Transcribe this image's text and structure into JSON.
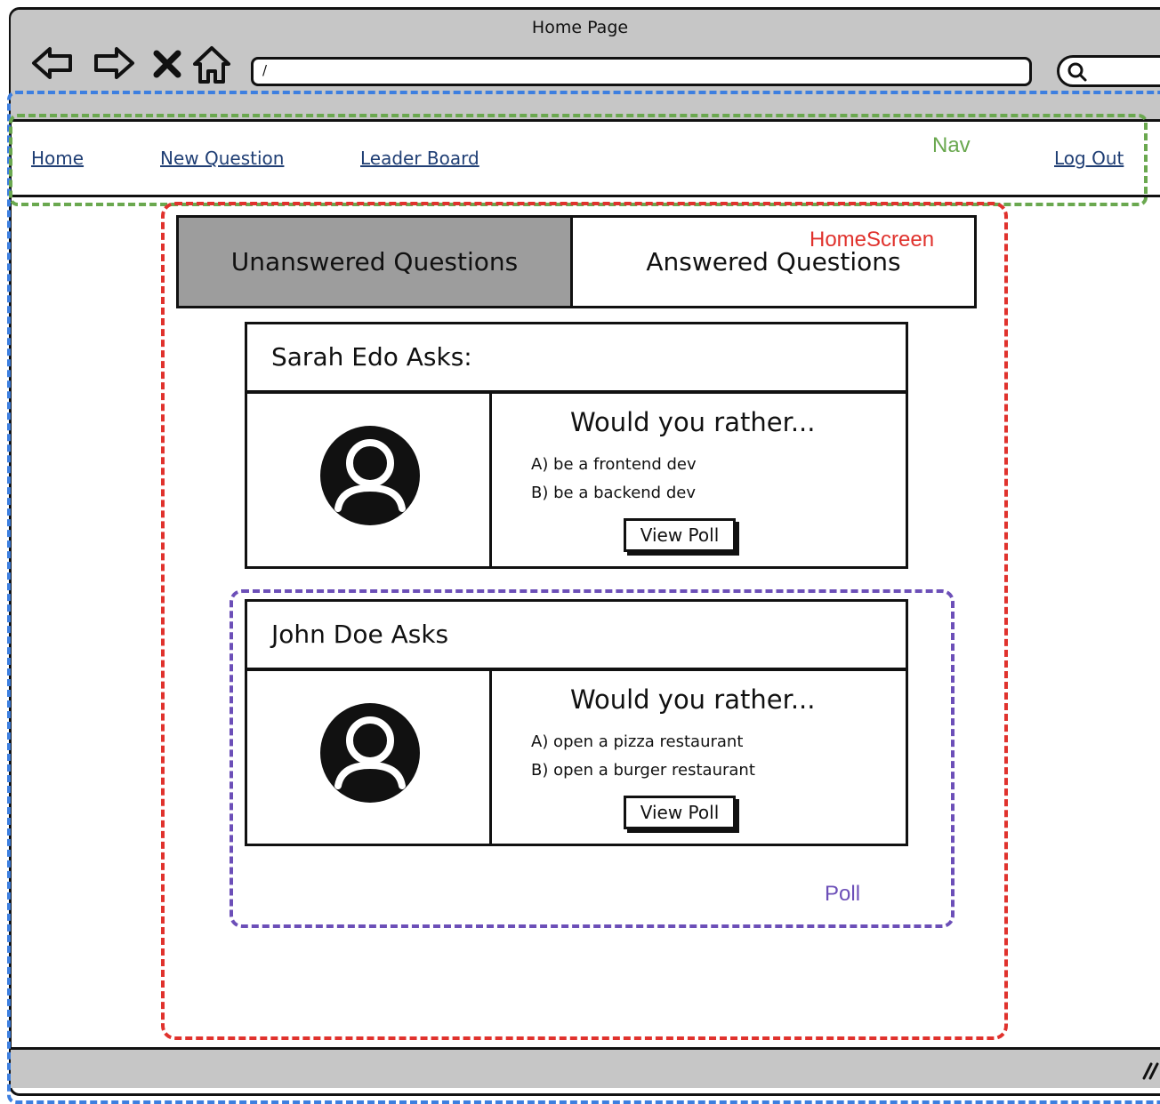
{
  "window": {
    "title": "Home Page"
  },
  "address_bar": {
    "value": "/"
  },
  "toolbar": {
    "back_icon": "back-arrow-icon",
    "forward_icon": "forward-arrow-icon",
    "stop_icon": "close-icon",
    "home_icon": "home-icon",
    "search_icon": "search-icon"
  },
  "nav": {
    "links": [
      "Home",
      "New Question",
      "Leader Board"
    ],
    "logout": "Log Out"
  },
  "annotations": {
    "nav": "Nav",
    "homescreen": "HomeScreen",
    "poll": "Poll",
    "colors": {
      "nav": "#6aa84f",
      "homescreen": "#e0322d",
      "poll": "#6c4fb8",
      "browser": "#3d7fe0"
    }
  },
  "tabs": {
    "unanswered": "Unanswered Questions",
    "answered": "Answered Questions"
  },
  "questions": [
    {
      "author": "Sarah Edo Asks:",
      "prompt": "Would you rather...",
      "option_a": "A) be a frontend dev",
      "option_b": "B) be a backend dev",
      "button": "View Poll"
    },
    {
      "author": "John Doe Asks",
      "prompt": "Would you rather...",
      "option_a": "A) open a pizza restaurant",
      "option_b": "B) open a burger restaurant",
      "button": "View Poll"
    }
  ]
}
